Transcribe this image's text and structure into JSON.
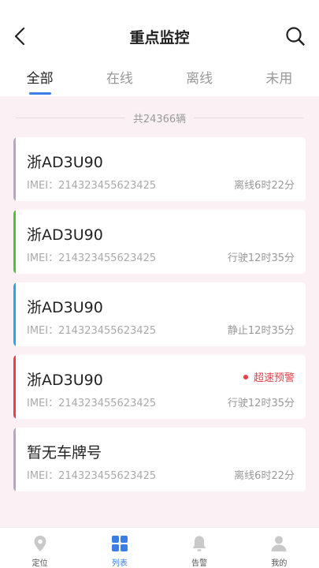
{
  "header": {
    "title": "重点监控",
    "back_icon": "chevron-left-icon",
    "search_icon": "search-icon"
  },
  "tabs": [
    {
      "label": "全部",
      "active": true
    },
    {
      "label": "在线",
      "active": false
    },
    {
      "label": "离线",
      "active": false
    },
    {
      "label": "未用",
      "active": false
    }
  ],
  "summary": {
    "count_text": "共24366辆"
  },
  "vehicles": [
    {
      "plate": "浙AD3U90",
      "imei": "IMEI：214323455623425",
      "status": "离线6时22分",
      "bar_color": "#b3a9c3",
      "alarm": ""
    },
    {
      "plate": "浙AD3U90",
      "imei": "IMEI：214323455623425",
      "status": "行驶12时35分",
      "bar_color": "#4fc23b",
      "alarm": ""
    },
    {
      "plate": "浙AD3U90",
      "imei": "IMEI：214323455623425",
      "status": "静止12时35分",
      "bar_color": "#28a8e0",
      "alarm": ""
    },
    {
      "plate": "浙AD3U90",
      "imei": "IMEI：214323455623425",
      "status": "行驶12时35分",
      "bar_color": "#e8404a",
      "alarm": "超速预警"
    },
    {
      "plate": "暂无车牌号",
      "imei": "IMEI：214323455623425",
      "status": "离线6时22分",
      "bar_color": "#b3a9c3",
      "alarm": ""
    }
  ],
  "bottom_nav": [
    {
      "label": "定位",
      "icon": "location-pin-icon",
      "active": false
    },
    {
      "label": "列表",
      "icon": "grid-icon",
      "active": true
    },
    {
      "label": "告警",
      "icon": "bell-icon",
      "active": false
    },
    {
      "label": "我的",
      "icon": "user-icon",
      "active": false
    }
  ],
  "colors": {
    "accent": "#3d7ee6",
    "alarm": "#e8404a",
    "content_bg": "#fbf1f4"
  }
}
